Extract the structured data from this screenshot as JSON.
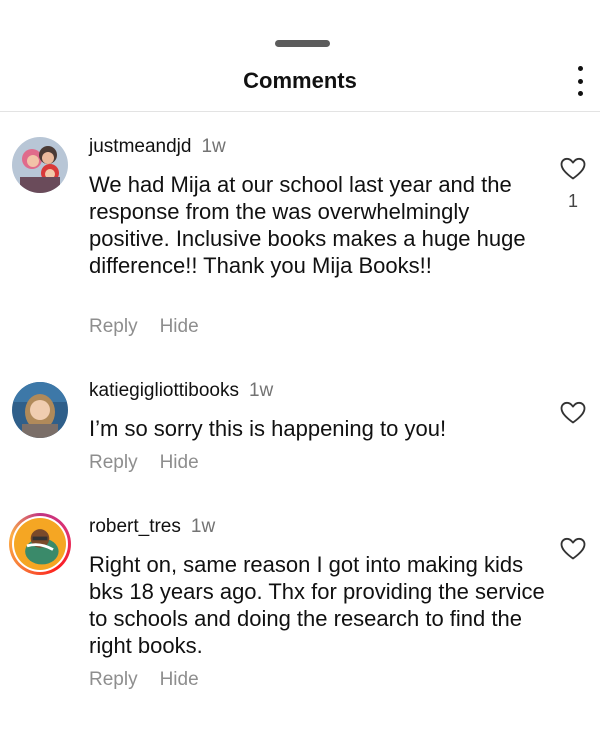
{
  "header": {
    "title": "Comments"
  },
  "comments": [
    {
      "username": "justmeandjd",
      "time": "1w",
      "text": "We had Mija at our school last year and the response from the was overwhelmingly positive. Inclusive books makes a huge huge difference!! Thank you Mija Books!!",
      "like_count": "1",
      "reply_label": "Reply",
      "hide_label": "Hide"
    },
    {
      "username": "katiegigliottibooks",
      "time": "1w",
      "text": "I’m so sorry this is happening to you!",
      "reply_label": "Reply",
      "hide_label": "Hide"
    },
    {
      "username": "robert_tres",
      "time": "1w",
      "text": "Right on, same reason I got into making kids bks 18 years ago. Thx for providing the service to schools and doing the research to find the right books.",
      "reply_label": "Reply",
      "hide_label": "Hide"
    }
  ],
  "icons": {
    "more": "more-vertical-icon",
    "like": "heart-outline-icon"
  }
}
